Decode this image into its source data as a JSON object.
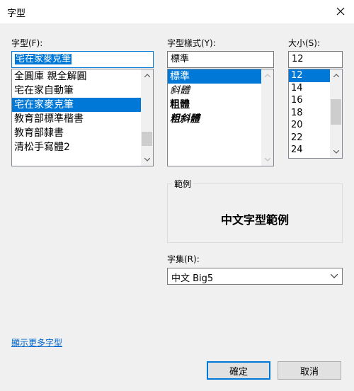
{
  "window": {
    "title": "字型"
  },
  "font": {
    "label": "字型(F):",
    "value": "宅在家麥克筆",
    "items": [
      "全圓庫 親全解圓",
      "宅在家自動筆",
      "宅在家麥克筆",
      "教育部標準楷書",
      "教育部隸書",
      "清松手寫體2"
    ],
    "selected_index": 2
  },
  "style": {
    "label": "字型樣式(Y):",
    "value": "標準",
    "items": [
      "標準",
      "斜體",
      "粗體",
      "粗斜體"
    ],
    "selected_index": 0
  },
  "size": {
    "label": "大小(S):",
    "value": "12",
    "items": [
      "12",
      "14",
      "16",
      "18",
      "20",
      "22",
      "24"
    ],
    "selected_index": 0
  },
  "sample": {
    "label": "範例",
    "text": "中文字型範例"
  },
  "script": {
    "label": "字集(R):",
    "value": "中文 Big5"
  },
  "more_fonts_link": "顯示更多字型",
  "buttons": {
    "ok": "確定",
    "cancel": "取消"
  },
  "colors": {
    "accent": "#0078d7",
    "link": "#0066cc"
  }
}
